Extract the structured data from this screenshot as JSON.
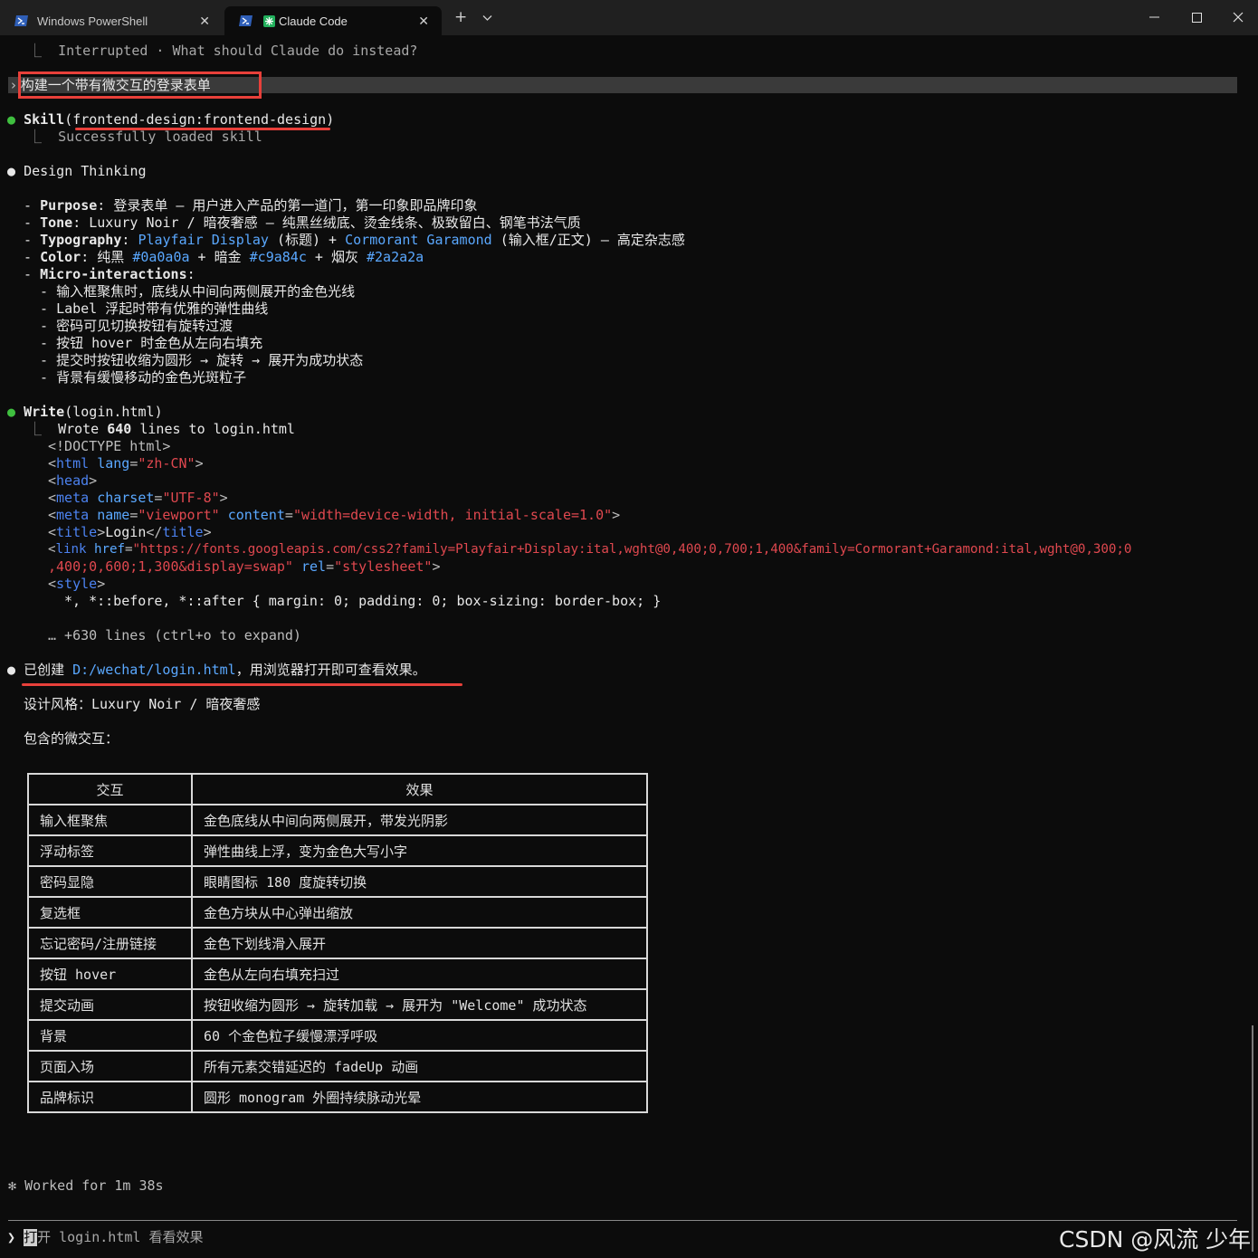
{
  "tabs": [
    {
      "label": "Windows PowerShell",
      "icon": "powershell-icon"
    },
    {
      "label": "Claude Code",
      "icon": "claude-icon"
    }
  ],
  "window": {
    "minimize": "─",
    "maximize": "☐",
    "close": "✕",
    "new_tab": "+",
    "dropdown": "⌄"
  },
  "interrupted": "Interrupted · What should Claude do instead?",
  "user_prompt": "构建一个带有微交互的登录表单",
  "skill": {
    "name": "Skill",
    "arg": "frontend-design:frontend-design",
    "result": "Successfully loaded skill"
  },
  "design": {
    "heading": "Design Thinking",
    "purpose_label": "Purpose",
    "purpose_text": "登录表单 – 用户进入产品的第一道门，第一印象即品牌印象",
    "tone_label": "Tone",
    "tone_text": "Luxury Noir / 暗夜奢感 – 纯黑丝绒底、烫金线条、极致留白、钢笔书法气质",
    "typo_label": "Typography",
    "typo_font1": "Playfair Display",
    "typo_mid": "(标题) + ",
    "typo_font2": "Cormorant Garamond",
    "typo_end": "(输入框/正文) – 高定杂志感",
    "color_label": "Color",
    "color_t1": "纯黑 ",
    "color_c1": "#0a0a0a",
    "color_t2": " + 暗金 ",
    "color_c2": "#c9a84c",
    "color_t3": " + 烟灰 ",
    "color_c3": "#2a2a2a",
    "micro_label": "Micro-interactions",
    "micro_items": [
      "输入框聚焦时，底线从中间向两侧展开的金色光线",
      "Label 浮起时带有优雅的弹性曲线",
      "密码可见切换按钮有旋转过渡",
      "按钮 hover 时金色从左向右填充",
      "提交时按钮收缩为圆形 → 旋转 → 展开为成功状态",
      "背景有缓慢移动的金色光斑粒子"
    ]
  },
  "write": {
    "tool": "Write",
    "file": "login.html",
    "wrote_prefix": "Wrote ",
    "wrote_count": "640",
    "wrote_suffix": " lines to login.html",
    "code": {
      "doctype": "<!DOCTYPE html>",
      "html_tag": "html",
      "lang_attr": "lang",
      "lang_val": "\"zh-CN\"",
      "head_tag": "head",
      "meta_tag": "meta",
      "charset_attr": "charset",
      "charset_val": "\"UTF-8\"",
      "name_attr": "name",
      "name_val": "\"viewport\"",
      "content_attr": "content",
      "content_val": "\"width=device-width, initial-scale=1.0\"",
      "title_tag": "title",
      "title_text": "Login",
      "link_tag": "link",
      "href_attr": "href",
      "href_val_1": "\"https://fonts.googleapis.com/css2?family=Playfair+Display:ital,wght@0,400;0,700;1,400&family=Cormorant+Garamond:ital,wght@0,300;0",
      "href_val_2": ",400;0,600;1,300&display=swap\"",
      "rel_attr": "rel",
      "rel_val": "\"stylesheet\"",
      "style_tag": "style",
      "css_line": "*, *::before, *::after { margin: 0; padding: 0; box-sizing: border-box; }",
      "expand": "… +630 lines (ctrl+o to expand)"
    }
  },
  "result": {
    "created_prefix": "已创建 ",
    "created_path": "D:/wechat/login.html",
    "created_suffix": "，用浏览器打开即可查看效果。",
    "style_line": "设计风格：Luxury Noir / 暗夜奢感",
    "include_line": "包含的微交互："
  },
  "table": {
    "headers": [
      "交互",
      "效果"
    ],
    "rows": [
      [
        "输入框聚焦",
        "金色底线从中间向两侧展开，带发光阴影"
      ],
      [
        "浮动标签",
        "弹性曲线上浮，变为金色大写小字"
      ],
      [
        "密码显隐",
        "眼睛图标 180 度旋转切换"
      ],
      [
        "复选框",
        "金色方块从中心弹出缩放"
      ],
      [
        "忘记密码/注册链接",
        "金色下划线滑入展开"
      ],
      [
        "按钮 hover",
        "金色从左向右填充扫过"
      ],
      [
        "提交动画",
        "按钮收缩为圆形 → 旋转加载 → 展开为 \"Welcome\" 成功状态"
      ],
      [
        "背景",
        "60 个金色粒子缓慢漂浮呼吸"
      ],
      [
        "页面入场",
        "所有元素交错延迟的 fadeUp 动画"
      ],
      [
        "品牌标识",
        "圆形 monogram 外圈持续脉动光晕"
      ]
    ]
  },
  "worked": "Worked for 1m 38s",
  "input": {
    "prompt_symbol": "❯",
    "cursor_char": "打",
    "text": "开 login.html 看看效果"
  },
  "watermark": "CSDN @风流 少年",
  "colors": {
    "accent_red": "#e8403a",
    "bullet_green": "#3fbf3f",
    "code_red": "#e0484f",
    "code_blue": "#4c82f0"
  }
}
